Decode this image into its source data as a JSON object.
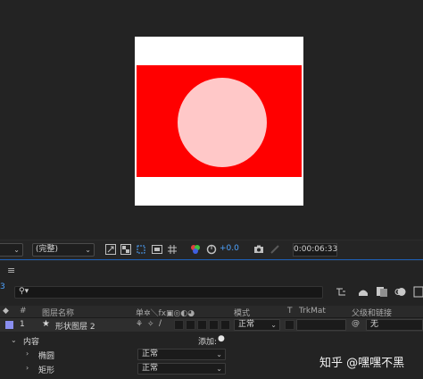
{
  "viewer": {
    "resolution_dropdown": "(完整)",
    "exposure_value": "+0.0",
    "timecode": "0:00:06:33"
  },
  "timeline": {
    "current_frame": "3",
    "headers": {
      "layer_name": "图层名称",
      "switches": "单✲＼fx▣◎◐◕",
      "mode": "模式",
      "t": "T",
      "trkmat": "TrkMat",
      "parent": "父级和链接"
    },
    "layer": {
      "number": "1",
      "name": "形状图层 2",
      "mode": "正常",
      "parent": "无"
    },
    "contents": {
      "label": "内容",
      "add_label": "添加:"
    },
    "groups": [
      {
        "name": "椭圆",
        "mode": "正常"
      },
      {
        "name": "矩形",
        "mode": "正常"
      }
    ]
  },
  "watermark": "知乎 @嘿嘿不黑",
  "colors": {
    "accent": "#4da3ff",
    "rect_fill": "#ff0000",
    "ellipse_fill": "#ffc8c8",
    "label_color": "#8a8ff0"
  }
}
